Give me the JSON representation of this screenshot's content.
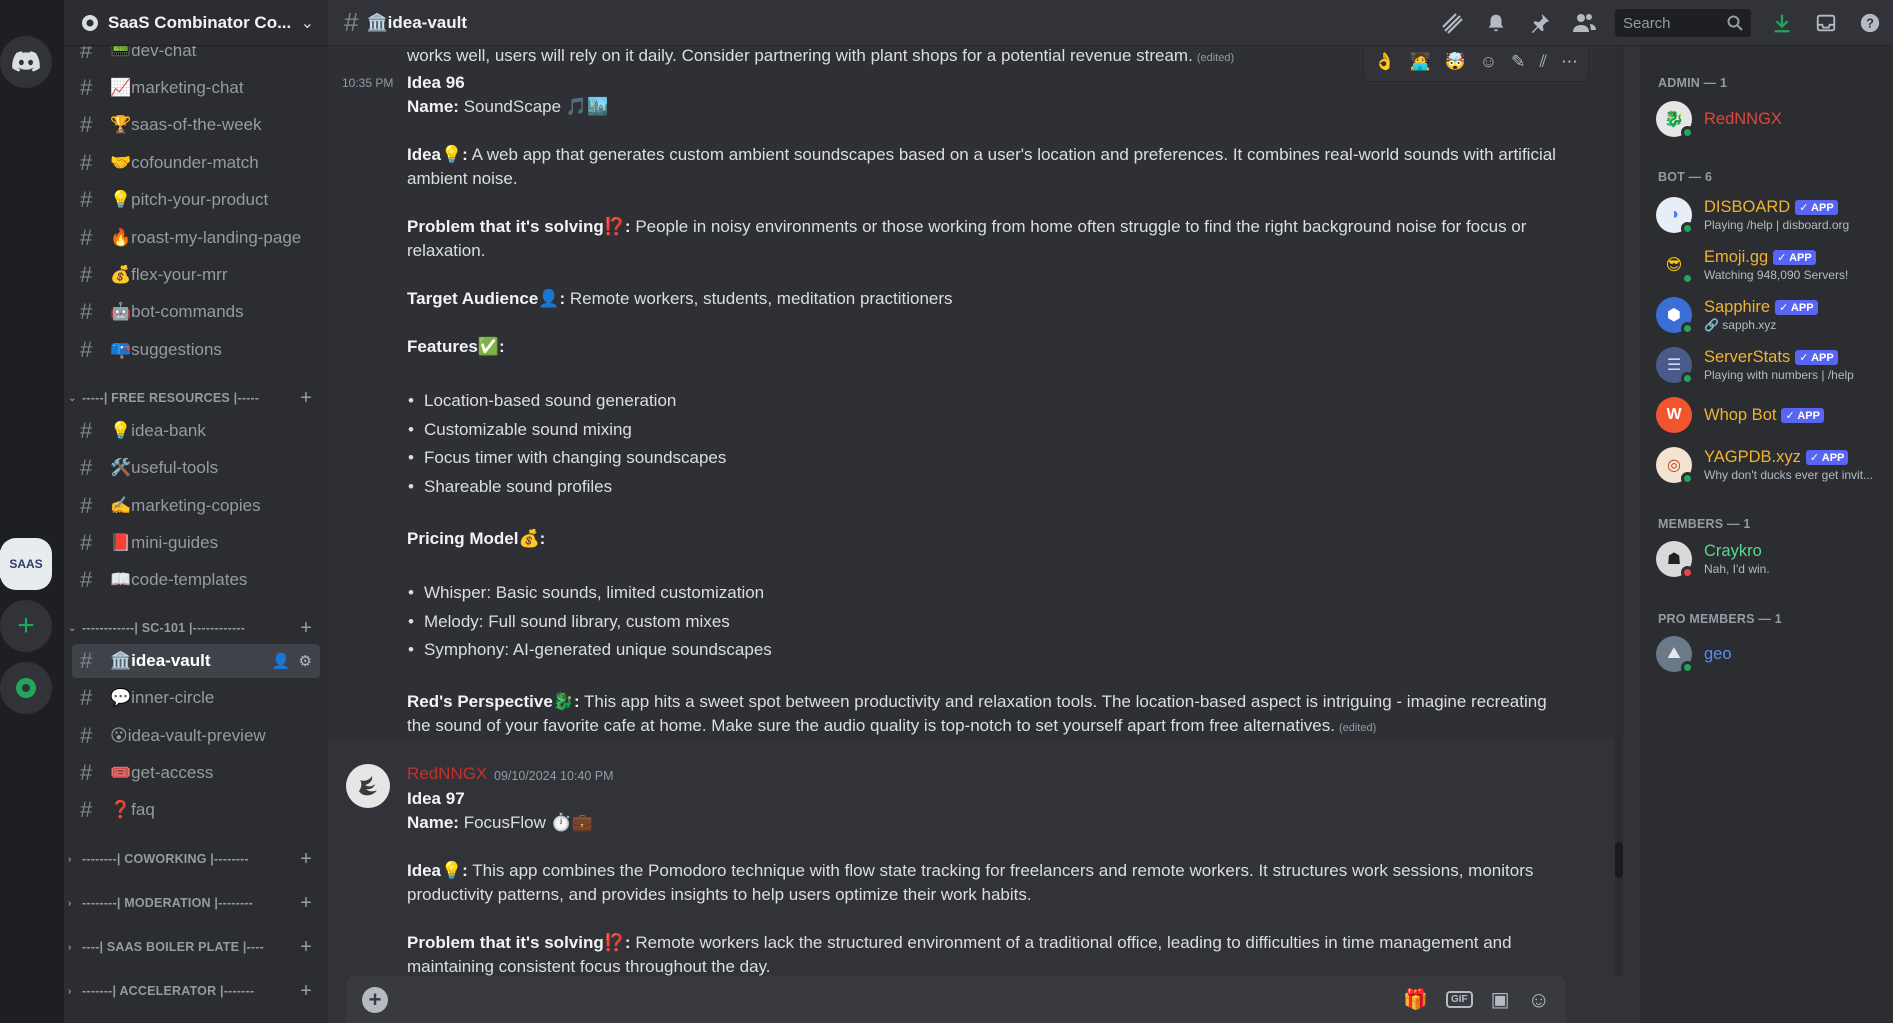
{
  "server": {
    "name": "SaaS Combinator Co...",
    "rail_label": "SAAS"
  },
  "channel": {
    "title": "🏛️idea-vault"
  },
  "search": {
    "placeholder": "Search"
  },
  "sidebar": {
    "top_channels": [
      {
        "name": "📟dev-chat"
      },
      {
        "name": "📈marketing-chat"
      },
      {
        "name": "🏆saas-of-the-week"
      },
      {
        "name": "🤝cofounder-match"
      },
      {
        "name": "💡pitch-your-product"
      },
      {
        "name": "🔥roast-my-landing-page"
      },
      {
        "name": "💰flex-your-mrr"
      },
      {
        "name": "🤖bot-commands"
      },
      {
        "name": "📪suggestions"
      }
    ],
    "cat_free": "-----| FREE RESOURCES |-----",
    "free_channels": [
      {
        "name": "💡idea-bank"
      },
      {
        "name": "🛠️useful-tools"
      },
      {
        "name": "✍️marketing-copies"
      },
      {
        "name": "📕mini-guides"
      },
      {
        "name": "📖code-templates"
      }
    ],
    "cat_sc101": "------------| SC-101 |------------",
    "sc101_channels": [
      {
        "name": "🏛️idea-vault"
      },
      {
        "name": "💬inner-circle"
      },
      {
        "name": "😮idea-vault-preview"
      },
      {
        "name": "🎟️get-access"
      },
      {
        "name": "❓faq"
      }
    ],
    "collapsed_categories": [
      "--------| COWORKING |--------",
      "--------| MODERATION |--------",
      "----| SAAS BOILER PLATE |----",
      "-------| ACCELERATOR |-------"
    ]
  },
  "chat": {
    "prev_tail": "works well, users will rely on it daily. Consider partnering with plant shops for a potential revenue stream.",
    "edited": "(edited)",
    "idea96": {
      "time": "10:35 PM",
      "title": "Idea 96",
      "name_label": "Name:",
      "name_value": "SoundScape 🎵🏙️",
      "idea_label": "Idea💡:",
      "idea_line1": "A web app that generates custom ambient soundscapes based on a user's location and preferences. It combines real-world sounds with artificial",
      "idea_line2": "ambient noise.",
      "problem_label": "Problem that it's solving⁉️:",
      "problem_line1": "People in noisy environments or those working from home often struggle to find the right background noise for focus or",
      "problem_line2": "relaxation.",
      "audience_label": "Target Audience👤:",
      "audience_value": "Remote workers, students, meditation practitioners",
      "features_label": "Features✅:",
      "features": [
        "Location-based sound generation",
        "Customizable sound mixing",
        "Focus timer with changing soundscapes",
        "Shareable sound profiles"
      ],
      "pricing_label": "Pricing Model💰:",
      "pricing": [
        "Whisper: Basic sounds, limited customization",
        "Melody: Full sound library, custom mixes",
        "Symphony: AI-generated unique soundscapes"
      ],
      "perspective_label": "Red's Perspective🐉:",
      "perspective_line1": "This app hits a sweet spot between productivity and relaxation tools. The location-based aspect is intriguing - imagine recreating",
      "perspective_line2": "the sound of your favorite cafe at home. Make sure the audio quality is top-notch to set yourself apart from free alternatives."
    },
    "idea97": {
      "author": "RedNNGX",
      "timestamp": "09/10/2024 10:40 PM",
      "title": "Idea 97",
      "name_label": "Name:",
      "name_value": "FocusFlow ⏱️💼",
      "idea_label": "Idea💡:",
      "idea_line1": "This app combines the Pomodoro technique with flow state tracking for freelancers and remote workers. It structures work sessions, monitors",
      "idea_line2": "productivity patterns, and provides insights to help users optimize their work habits.",
      "problem_label": "Problem that it's solving⁉️:",
      "problem_line1": "Remote workers lack the structured environment of a traditional office, leading to difficulties in time management and",
      "problem_line2": "maintaining consistent focus throughout the day."
    },
    "reactions": [
      "👌",
      "🧑‍💻",
      "🤯"
    ]
  },
  "composer": {
    "gif_label": "GIF"
  },
  "members": {
    "admin_header": "ADMIN — 1",
    "admin": [
      {
        "name": "RedNNGX",
        "color": "#e0463c"
      }
    ],
    "bot_header": "BOT — 6",
    "bots": [
      {
        "name": "DISBOARD",
        "sub": "Playing /help | disboard.org",
        "tag": "✓ APP"
      },
      {
        "name": "Emoji.gg",
        "sub": "Watching 948,090 Servers!",
        "tag": "✓ APP"
      },
      {
        "name": "Sapphire",
        "sub": "🔗 sapph.xyz",
        "tag": "✓ APP"
      },
      {
        "name": "ServerStats",
        "sub": "Playing with numbers | /help",
        "tag": "✓ APP"
      },
      {
        "name": "Whop Bot",
        "sub": "",
        "tag": "✓ APP"
      },
      {
        "name": "YAGPDB.xyz",
        "sub": "Why don't ducks ever get invit...",
        "tag": "✓ APP"
      }
    ],
    "members_header": "MEMBERS — 1",
    "members": [
      {
        "name": "Craykro",
        "sub": "Nah, I'd win."
      }
    ],
    "pro_header": "PRO MEMBERS — 1",
    "pro": [
      {
        "name": "geo"
      }
    ],
    "colors": {
      "admin": "#e0463c",
      "bot": "#f0b232",
      "member": "#57d98e",
      "pro": "#5a8dee"
    }
  }
}
